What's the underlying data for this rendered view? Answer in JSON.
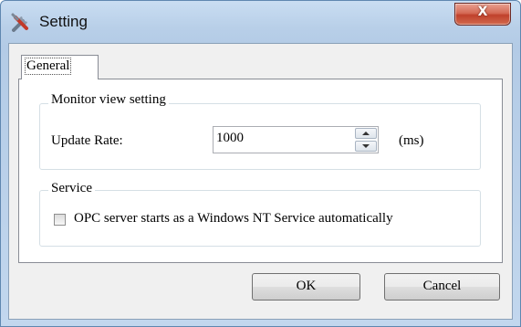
{
  "window": {
    "title": "Setting",
    "close_label": "X"
  },
  "tabs": [
    {
      "label": "General",
      "selected": true
    }
  ],
  "monitor_group": {
    "legend": "Monitor view setting",
    "update_rate_label": "Update Rate:",
    "update_rate_value": "1000",
    "unit": "(ms)"
  },
  "service_group": {
    "legend": "Service",
    "checkbox_label": "OPC server starts as a Windows NT Service automatically",
    "checked": false
  },
  "buttons": {
    "ok": "OK",
    "cancel": "Cancel"
  },
  "icons": {
    "app": "tools-icon"
  }
}
